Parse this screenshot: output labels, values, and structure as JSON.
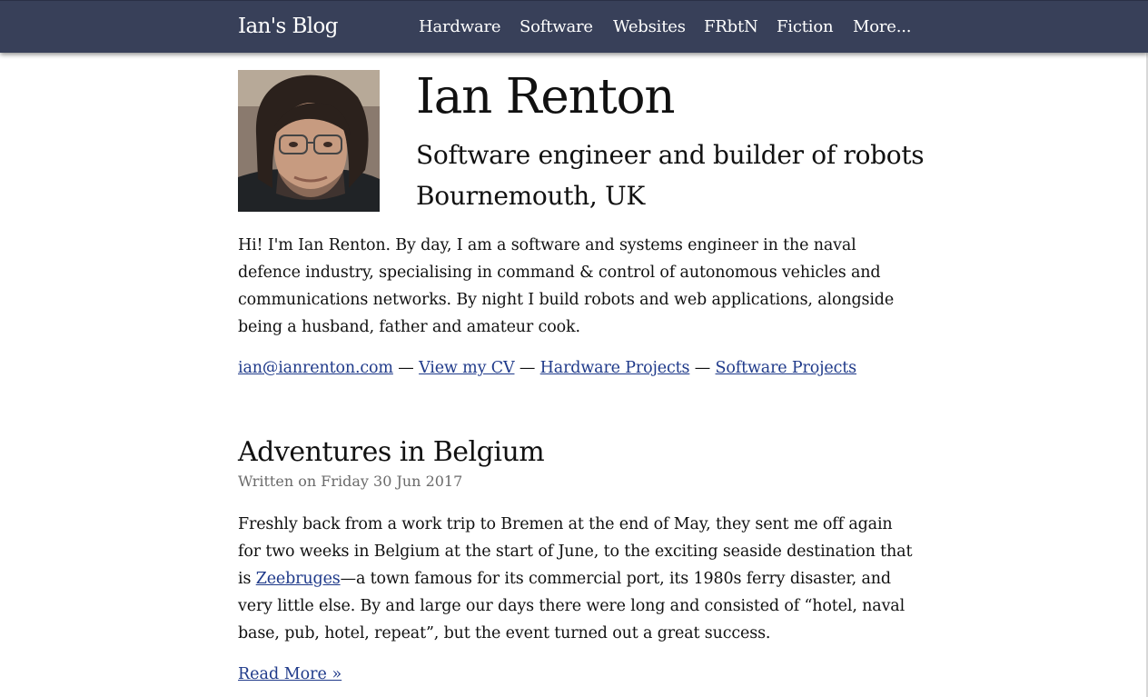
{
  "nav": {
    "brand": "Ian's Blog",
    "links": [
      "Hardware",
      "Software",
      "Websites",
      "FRbtN",
      "Fiction",
      "More..."
    ]
  },
  "profile": {
    "name": "Ian Renton",
    "tagline": "Software engineer and builder of robots",
    "location": "Bournemouth, UK",
    "bio": "Hi! I'm Ian Renton. By day, I am a software and systems engineer in the naval defence industry, specialising in command & control of autonomous vehicles and communications networks. By night I build robots and web applications, alongside being a husband, father and amateur cook.",
    "contact": {
      "email": "ian@ianrenton.com",
      "cv": "View my CV",
      "hardware": "Hardware Projects",
      "software": "Software Projects",
      "separator": " — "
    }
  },
  "post": {
    "title": "Adventures in Belgium",
    "meta": "Written on Friday 30 Jun 2017",
    "body_before_link": "Freshly back from a work trip to Bremen at the end of May, they sent me off again for two weeks in Belgium at the start of June, to the exciting seaside destination that is ",
    "link_text": "Zeebruges",
    "body_after_link": "—a town famous for its commercial port, its 1980s ferry disaster, and very little else. By and large our days there were long and consisted of “hotel, naval base, pub, hotel, repeat”, but the event turned out a great success.",
    "read_more": "Read More »"
  },
  "colors": {
    "navbar_bg": "#384059",
    "link": "#1f3a8a",
    "meta_text": "#6a6a6a"
  }
}
